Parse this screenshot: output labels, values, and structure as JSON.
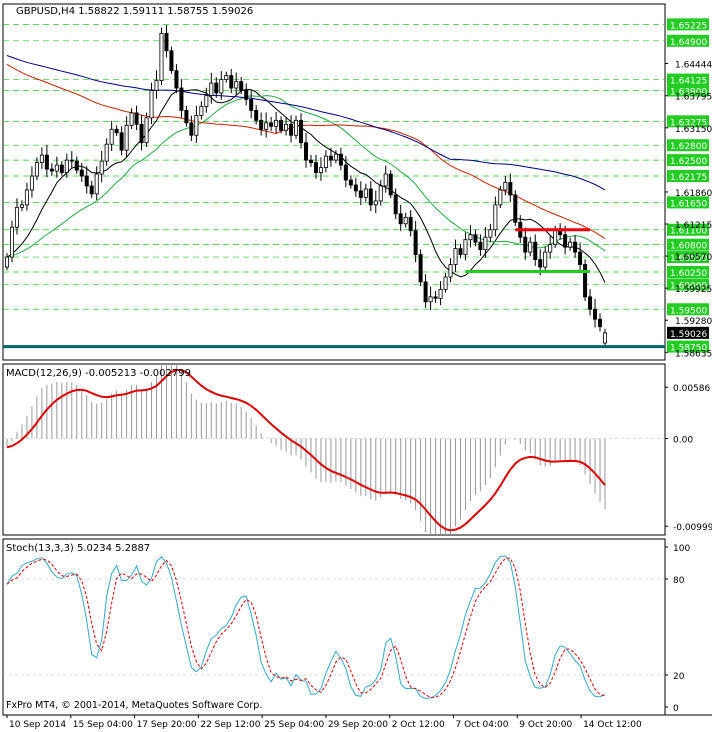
{
  "chart_data": [
    {
      "type": "candlestick",
      "title": "GBPUSD,H4  1.58822 1.59111 1.58755 1.59026",
      "symbol": "GBPUSD",
      "timeframe": "H4",
      "last_bar": {
        "open": 1.58822,
        "high": 1.59111,
        "low": 1.58755,
        "close": 1.59026
      },
      "ylim": [
        1.5848,
        1.6564
      ],
      "y_ticks": [
        1.64444,
        1.63795,
        1.6315,
        1.6186,
        1.61215,
        1.6057,
        1.59925,
        1.5928,
        1.58635
      ],
      "price_levels": [
        1.6523,
        1.649,
        1.6412,
        1.639,
        1.6328,
        1.628,
        1.625,
        1.6218,
        1.6165,
        1.611,
        1.608,
        1.6055,
        1.6025,
        1.6,
        1.595,
        1.5875
      ],
      "price_level_labels": [
        "1.65225",
        "1.64900",
        "1.64125",
        "1.63900",
        "1.63275",
        "1.62800",
        "1.62500",
        "1.62175",
        "1.61650",
        "1.61100",
        "1.60800",
        "1.60550",
        "1.60250",
        "1.60000",
        "1.59500",
        "1.58750"
      ],
      "current_price": 1.59026,
      "current_price_label": "1.59026",
      "support_price": 1.5875,
      "support_label": "1.58750",
      "resistance_segment": {
        "from_bar": 102,
        "to_bar": 117,
        "price": 1.611
      },
      "support_segment": {
        "from_bar": 92,
        "to_bar": 117,
        "price": 1.6026
      },
      "closes": [
        1.6055,
        1.6115,
        1.6155,
        1.616,
        1.619,
        1.6218,
        1.6245,
        1.626,
        1.6232,
        1.6228,
        1.624,
        1.6225,
        1.625,
        1.6248,
        1.623,
        1.6218,
        1.6198,
        1.6182,
        1.6222,
        1.6248,
        1.6282,
        1.6312,
        1.6305,
        1.627,
        1.632,
        1.6345,
        1.6322,
        1.6285,
        1.6335,
        1.639,
        1.641,
        1.6505,
        1.647,
        1.643,
        1.6395,
        1.635,
        1.6325,
        1.63,
        1.634,
        1.6358,
        1.638,
        1.6405,
        1.6385,
        1.6412,
        1.642,
        1.6395,
        1.6408,
        1.639,
        1.6372,
        1.635,
        1.633,
        1.6312,
        1.6325,
        1.6318,
        1.633,
        1.631,
        1.6322,
        1.63,
        1.633,
        1.6285,
        1.625,
        1.6245,
        1.6225,
        1.6235,
        1.6258,
        1.625,
        1.6262,
        1.624,
        1.621,
        1.62,
        1.6188,
        1.6175,
        1.6192,
        1.616,
        1.6168,
        1.6198,
        1.6222,
        1.618,
        1.6142,
        1.6122,
        1.6135,
        1.6108,
        1.606,
        1.6005,
        1.5965,
        1.5975,
        1.5972,
        1.599,
        1.6015,
        1.604,
        1.6072,
        1.606,
        1.609,
        1.61,
        1.6085,
        1.607,
        1.6095,
        1.611,
        1.616,
        1.619,
        1.6205,
        1.618,
        1.6125,
        1.6095,
        1.6065,
        1.6085,
        1.605,
        1.6035,
        1.6065,
        1.608,
        1.611,
        1.61,
        1.6075,
        1.6085,
        1.6065,
        1.604,
        1.5975,
        1.595,
        1.593,
        1.5915,
        1.5903
      ],
      "moving_averages": [
        {
          "color": "#000000",
          "period": 10
        },
        {
          "color": "#22aa44",
          "period": 25
        },
        {
          "color": "#cc2200",
          "period": 55
        },
        {
          "color": "#000088",
          "period": 90
        }
      ]
    },
    {
      "type": "histogram+line",
      "title": "MACD(12,26,9) -0.005213 -0.002799",
      "ylim": [
        -0.011,
        0.0085
      ],
      "y_ticks": [
        0.00586,
        0.0,
        -0.009997
      ],
      "y_tick_labels": [
        "0.00586",
        "0.00",
        "-0.009997"
      ]
    },
    {
      "type": "line",
      "title": "Stoch(13,3,3) 5.0234 5.2887",
      "ylim": [
        0,
        100
      ],
      "y_ticks": [
        100,
        80,
        20,
        0
      ],
      "y_tick_labels": [
        "100",
        "80",
        "20",
        "0"
      ]
    }
  ],
  "x_labels": [
    "10 Sep 2014",
    "15 Sep 04:00",
    "17 Sep 20:00",
    "22 Sep 12:00",
    "25 Sep 04:00",
    "29 Sep 20:00",
    "2 Oct 12:00",
    "7 Oct 04:00",
    "9 Oct 20:00",
    "14 Oct 12:00"
  ],
  "x_label_bars": [
    0,
    16,
    32,
    48,
    64,
    80,
    96,
    112,
    128,
    144
  ],
  "copyright": "FxPro MT4, © 2001-2014, MetaQuotes Software Corp.",
  "colors": {
    "background": "#ffffff",
    "grid": "#22cc22",
    "candle": "#000000",
    "macd_signal": "#dd0000",
    "macd_hist": "#999999",
    "stoch_main": "#33aacc",
    "stoch_signal": "#dd0000",
    "resistance": "#ee0000",
    "support": "#22cc22",
    "support_base": "#006666",
    "price_label_bg": "#22cc22",
    "current_label_bg": "#000000"
  }
}
